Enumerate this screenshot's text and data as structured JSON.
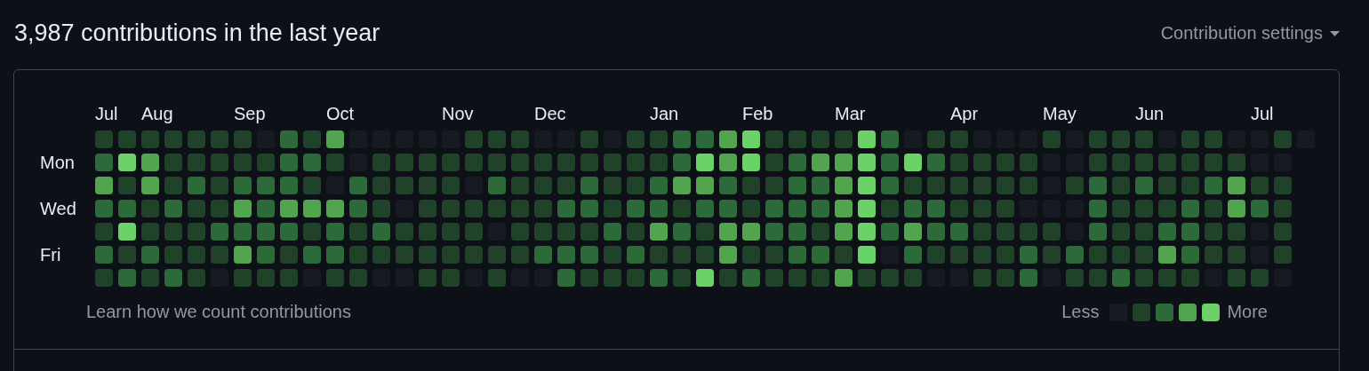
{
  "header": {
    "title": "3,987 contributions in the last year",
    "settings_label": "Contribution settings"
  },
  "day_labels": [
    "Mon",
    "Wed",
    "Fri"
  ],
  "weeks": [
    {
      "month": "Jul",
      "days": [
        {
          "color": "#1f4229"
        },
        {
          "color": "#2d6a39"
        },
        {
          "color": "#52a44e"
        },
        {
          "color": "#2d6a39"
        },
        {
          "color": "#1f4229"
        },
        {
          "color": "#2d6a39"
        },
        {
          "color": "#1f4229"
        }
      ]
    },
    {
      "days": [
        {
          "color": "#1f4229"
        },
        {
          "color": "#6bd267"
        },
        {
          "color": "#1f4229"
        },
        {
          "color": "#2d6a39"
        },
        {
          "color": "#6bd267"
        },
        {
          "color": "#1f4229"
        },
        {
          "color": "#2d6a39"
        }
      ]
    },
    {
      "month": "Aug",
      "days": [
        {
          "color": "#1f4229"
        },
        {
          "color": "#52a44e"
        },
        {
          "color": "#52a44e"
        },
        {
          "color": "#1f4229"
        },
        {
          "color": "#1f4229"
        },
        {
          "color": "#2d6a39"
        },
        {
          "color": "#1f4229"
        }
      ]
    },
    {
      "days": [
        {
          "color": "#1f4229"
        },
        {
          "color": "#1f4229"
        },
        {
          "color": "#1f4229"
        },
        {
          "color": "#2d6a39"
        },
        {
          "color": "#1f4229"
        },
        {
          "color": "#1f4229"
        },
        {
          "color": "#2d6a39"
        }
      ]
    },
    {
      "days": [
        {
          "color": "#1f4229"
        },
        {
          "color": "#1f4229"
        },
        {
          "color": "#2d6a39"
        },
        {
          "color": "#1f4229"
        },
        {
          "color": "#1f4229"
        },
        {
          "color": "#1f4229"
        },
        {
          "color": "#1f4229"
        }
      ]
    },
    {
      "days": [
        {
          "color": "#1f4229"
        },
        {
          "color": "#1f4229"
        },
        {
          "color": "#1f4229"
        },
        {
          "color": "#1f4229"
        },
        {
          "color": "#2d6a39"
        },
        {
          "color": "#1f4229"
        },
        {
          "color": "#161b22"
        }
      ]
    },
    {
      "month": "Sep",
      "days": [
        {
          "color": "#1f4229"
        },
        {
          "color": "#1f4229"
        },
        {
          "color": "#2d6a39"
        },
        {
          "color": "#52a44e"
        },
        {
          "color": "#2d6a39"
        },
        {
          "color": "#52a44e"
        },
        {
          "color": "#1f4229"
        }
      ]
    },
    {
      "days": [
        {
          "color": "#161b22"
        },
        {
          "color": "#1f4229"
        },
        {
          "color": "#2d6a39"
        },
        {
          "color": "#2d6a39"
        },
        {
          "color": "#2d6a39"
        },
        {
          "color": "#2d6a39"
        },
        {
          "color": "#1f4229"
        }
      ]
    },
    {
      "days": [
        {
          "color": "#2d6a39"
        },
        {
          "color": "#2d6a39"
        },
        {
          "color": "#2d6a39"
        },
        {
          "color": "#52a44e"
        },
        {
          "color": "#2d6a39"
        },
        {
          "color": "#1f4229"
        },
        {
          "color": "#1f4229"
        }
      ]
    },
    {
      "days": [
        {
          "color": "#1f4229"
        },
        {
          "color": "#2d6a39"
        },
        {
          "color": "#1f4229"
        },
        {
          "color": "#52a44e"
        },
        {
          "color": "#1f4229"
        },
        {
          "color": "#2d6a39"
        },
        {
          "color": "#161b22"
        }
      ]
    },
    {
      "month": "Oct",
      "days": [
        {
          "color": "#52a44e"
        },
        {
          "color": "#1f4229"
        },
        {
          "color": "#161b22"
        },
        {
          "color": "#52a44e"
        },
        {
          "color": "#2d6a39"
        },
        {
          "color": "#2d6a39"
        },
        {
          "color": "#1f4229"
        }
      ]
    },
    {
      "days": [
        {
          "color": "#161b22"
        },
        {
          "color": "#161b22"
        },
        {
          "color": "#2d6a39"
        },
        {
          "color": "#2d6a39"
        },
        {
          "color": "#1f4229"
        },
        {
          "color": "#1f4229"
        },
        {
          "color": "#1f4229"
        }
      ]
    },
    {
      "days": [
        {
          "color": "#161b22"
        },
        {
          "color": "#1f4229"
        },
        {
          "color": "#1f4229"
        },
        {
          "color": "#1f4229"
        },
        {
          "color": "#2d6a39"
        },
        {
          "color": "#1f4229"
        },
        {
          "color": "#161b22"
        }
      ]
    },
    {
      "days": [
        {
          "color": "#161b22"
        },
        {
          "color": "#1f4229"
        },
        {
          "color": "#1f4229"
        },
        {
          "color": "#161b22"
        },
        {
          "color": "#1f4229"
        },
        {
          "color": "#1f4229"
        },
        {
          "color": "#161b22"
        }
      ]
    },
    {
      "days": [
        {
          "color": "#161b22"
        },
        {
          "color": "#1f4229"
        },
        {
          "color": "#1f4229"
        },
        {
          "color": "#1f4229"
        },
        {
          "color": "#1f4229"
        },
        {
          "color": "#1f4229"
        },
        {
          "color": "#1f4229"
        }
      ]
    },
    {
      "month": "Nov",
      "days": [
        {
          "color": "#161b22"
        },
        {
          "color": "#1f4229"
        },
        {
          "color": "#1f4229"
        },
        {
          "color": "#1f4229"
        },
        {
          "color": "#1f4229"
        },
        {
          "color": "#1f4229"
        },
        {
          "color": "#1f4229"
        }
      ]
    },
    {
      "days": [
        {
          "color": "#1f4229"
        },
        {
          "color": "#1f4229"
        },
        {
          "color": "#161b22"
        },
        {
          "color": "#1f4229"
        },
        {
          "color": "#1f4229"
        },
        {
          "color": "#1f4229"
        },
        {
          "color": "#161b22"
        }
      ]
    },
    {
      "days": [
        {
          "color": "#1f4229"
        },
        {
          "color": "#1f4229"
        },
        {
          "color": "#2d6a39"
        },
        {
          "color": "#1f4229"
        },
        {
          "color": "#161b22"
        },
        {
          "color": "#1f4229"
        },
        {
          "color": "#1f4229"
        }
      ]
    },
    {
      "days": [
        {
          "color": "#1f4229"
        },
        {
          "color": "#1f4229"
        },
        {
          "color": "#1f4229"
        },
        {
          "color": "#1f4229"
        },
        {
          "color": "#1f4229"
        },
        {
          "color": "#1f4229"
        },
        {
          "color": "#161b22"
        }
      ]
    },
    {
      "month": "Dec",
      "days": [
        {
          "color": "#161b22"
        },
        {
          "color": "#1f4229"
        },
        {
          "color": "#1f4229"
        },
        {
          "color": "#1f4229"
        },
        {
          "color": "#1f4229"
        },
        {
          "color": "#2d6a39"
        },
        {
          "color": "#161b22"
        }
      ]
    },
    {
      "days": [
        {
          "color": "#161b22"
        },
        {
          "color": "#1f4229"
        },
        {
          "color": "#1f4229"
        },
        {
          "color": "#2d6a39"
        },
        {
          "color": "#1f4229"
        },
        {
          "color": "#2d6a39"
        },
        {
          "color": "#2d6a39"
        }
      ]
    },
    {
      "days": [
        {
          "color": "#1f4229"
        },
        {
          "color": "#1f4229"
        },
        {
          "color": "#2d6a39"
        },
        {
          "color": "#2d6a39"
        },
        {
          "color": "#1f4229"
        },
        {
          "color": "#2d6a39"
        },
        {
          "color": "#1f4229"
        }
      ]
    },
    {
      "days": [
        {
          "color": "#161b22"
        },
        {
          "color": "#1f4229"
        },
        {
          "color": "#1f4229"
        },
        {
          "color": "#1f4229"
        },
        {
          "color": "#2d6a39"
        },
        {
          "color": "#1f4229"
        },
        {
          "color": "#1f4229"
        }
      ]
    },
    {
      "days": [
        {
          "color": "#1f4229"
        },
        {
          "color": "#1f4229"
        },
        {
          "color": "#1f4229"
        },
        {
          "color": "#2d6a39"
        },
        {
          "color": "#1f4229"
        },
        {
          "color": "#2d6a39"
        },
        {
          "color": "#1f4229"
        }
      ]
    },
    {
      "month": "Jan",
      "days": [
        {
          "color": "#1f4229"
        },
        {
          "color": "#1f4229"
        },
        {
          "color": "#2d6a39"
        },
        {
          "color": "#2d6a39"
        },
        {
          "color": "#52a44e"
        },
        {
          "color": "#1f4229"
        },
        {
          "color": "#2d6a39"
        }
      ]
    },
    {
      "days": [
        {
          "color": "#2d6a39"
        },
        {
          "color": "#2d6a39"
        },
        {
          "color": "#52a44e"
        },
        {
          "color": "#1f4229"
        },
        {
          "color": "#2d6a39"
        },
        {
          "color": "#1f4229"
        },
        {
          "color": "#1f4229"
        }
      ]
    },
    {
      "days": [
        {
          "color": "#2d6a39"
        },
        {
          "color": "#6bd267"
        },
        {
          "color": "#52a44e"
        },
        {
          "color": "#2d6a39"
        },
        {
          "color": "#1f4229"
        },
        {
          "color": "#1f4229"
        },
        {
          "color": "#6bd267"
        }
      ]
    },
    {
      "days": [
        {
          "color": "#52a44e"
        },
        {
          "color": "#52a44e"
        },
        {
          "color": "#2d6a39"
        },
        {
          "color": "#2d6a39"
        },
        {
          "color": "#52a44e"
        },
        {
          "color": "#52a44e"
        },
        {
          "color": "#1f4229"
        }
      ]
    },
    {
      "month": "Feb",
      "days": [
        {
          "color": "#6bd267"
        },
        {
          "color": "#6bd267"
        },
        {
          "color": "#1f4229"
        },
        {
          "color": "#1f4229"
        },
        {
          "color": "#52a44e"
        },
        {
          "color": "#1f4229"
        },
        {
          "color": "#2d6a39"
        }
      ]
    },
    {
      "days": [
        {
          "color": "#1f4229"
        },
        {
          "color": "#1f4229"
        },
        {
          "color": "#1f4229"
        },
        {
          "color": "#2d6a39"
        },
        {
          "color": "#2d6a39"
        },
        {
          "color": "#1f4229"
        },
        {
          "color": "#1f4229"
        }
      ]
    },
    {
      "days": [
        {
          "color": "#1f4229"
        },
        {
          "color": "#2d6a39"
        },
        {
          "color": "#2d6a39"
        },
        {
          "color": "#2d6a39"
        },
        {
          "color": "#2d6a39"
        },
        {
          "color": "#2d6a39"
        },
        {
          "color": "#1f4229"
        }
      ]
    },
    {
      "days": [
        {
          "color": "#1f4229"
        },
        {
          "color": "#52a44e"
        },
        {
          "color": "#2d6a39"
        },
        {
          "color": "#2d6a39"
        },
        {
          "color": "#1f4229"
        },
        {
          "color": "#2d6a39"
        },
        {
          "color": "#1f4229"
        }
      ]
    },
    {
      "month": "Mar",
      "days": [
        {
          "color": "#1f4229"
        },
        {
          "color": "#52a44e"
        },
        {
          "color": "#52a44e"
        },
        {
          "color": "#52a44e"
        },
        {
          "color": "#52a44e"
        },
        {
          "color": "#1f4229"
        },
        {
          "color": "#52a44e"
        }
      ]
    },
    {
      "days": [
        {
          "color": "#6bd267"
        },
        {
          "color": "#6bd267"
        },
        {
          "color": "#6bd267"
        },
        {
          "color": "#6bd267"
        },
        {
          "color": "#6bd267"
        },
        {
          "color": "#6bd267"
        },
        {
          "color": "#1f4229"
        }
      ]
    },
    {
      "days": [
        {
          "color": "#2d6a39"
        },
        {
          "color": "#2d6a39"
        },
        {
          "color": "#2d6a39"
        },
        {
          "color": "#1f4229"
        },
        {
          "color": "#2d6a39"
        },
        {
          "color": "#161b22"
        },
        {
          "color": "#1f4229"
        }
      ]
    },
    {
      "days": [
        {
          "color": "#161b22"
        },
        {
          "color": "#6bd267"
        },
        {
          "color": "#1f4229"
        },
        {
          "color": "#2d6a39"
        },
        {
          "color": "#52a44e"
        },
        {
          "color": "#2d6a39"
        },
        {
          "color": "#1f4229"
        }
      ]
    },
    {
      "days": [
        {
          "color": "#1f4229"
        },
        {
          "color": "#2d6a39"
        },
        {
          "color": "#1f4229"
        },
        {
          "color": "#2d6a39"
        },
        {
          "color": "#2d6a39"
        },
        {
          "color": "#1f4229"
        },
        {
          "color": "#161b22"
        }
      ]
    },
    {
      "month": "Apr",
      "days": [
        {
          "color": "#1f4229"
        },
        {
          "color": "#1f4229"
        },
        {
          "color": "#1f4229"
        },
        {
          "color": "#1f4229"
        },
        {
          "color": "#2d6a39"
        },
        {
          "color": "#1f4229"
        },
        {
          "color": "#161b22"
        }
      ]
    },
    {
      "days": [
        {
          "color": "#161b22"
        },
        {
          "color": "#1f4229"
        },
        {
          "color": "#1f4229"
        },
        {
          "color": "#1f4229"
        },
        {
          "color": "#1f4229"
        },
        {
          "color": "#1f4229"
        },
        {
          "color": "#1f4229"
        }
      ]
    },
    {
      "days": [
        {
          "color": "#161b22"
        },
        {
          "color": "#1f4229"
        },
        {
          "color": "#1f4229"
        },
        {
          "color": "#1f4229"
        },
        {
          "color": "#1f4229"
        },
        {
          "color": "#1f4229"
        },
        {
          "color": "#1f4229"
        }
      ]
    },
    {
      "days": [
        {
          "color": "#161b22"
        },
        {
          "color": "#1f4229"
        },
        {
          "color": "#1f4229"
        },
        {
          "color": "#161b22"
        },
        {
          "color": "#1f4229"
        },
        {
          "color": "#2d6a39"
        },
        {
          "color": "#2d6a39"
        }
      ]
    },
    {
      "month": "May",
      "days": [
        {
          "color": "#1f4229"
        },
        {
          "color": "#161b22"
        },
        {
          "color": "#161b22"
        },
        {
          "color": "#161b22"
        },
        {
          "color": "#1f4229"
        },
        {
          "color": "#1f4229"
        },
        {
          "color": "#161b22"
        }
      ]
    },
    {
      "days": [
        {
          "color": "#161b22"
        },
        {
          "color": "#161b22"
        },
        {
          "color": "#1f4229"
        },
        {
          "color": "#161b22"
        },
        {
          "color": "#161b22"
        },
        {
          "color": "#2d6a39"
        },
        {
          "color": "#1f4229"
        }
      ]
    },
    {
      "days": [
        {
          "color": "#1f4229"
        },
        {
          "color": "#1f4229"
        },
        {
          "color": "#2d6a39"
        },
        {
          "color": "#2d6a39"
        },
        {
          "color": "#2d6a39"
        },
        {
          "color": "#1f4229"
        },
        {
          "color": "#1f4229"
        }
      ]
    },
    {
      "days": [
        {
          "color": "#1f4229"
        },
        {
          "color": "#1f4229"
        },
        {
          "color": "#1f4229"
        },
        {
          "color": "#1f4229"
        },
        {
          "color": "#1f4229"
        },
        {
          "color": "#1f4229"
        },
        {
          "color": "#2d6a39"
        }
      ]
    },
    {
      "month": "Jun",
      "days": [
        {
          "color": "#1f4229"
        },
        {
          "color": "#1f4229"
        },
        {
          "color": "#2d6a39"
        },
        {
          "color": "#1f4229"
        },
        {
          "color": "#1f4229"
        },
        {
          "color": "#1f4229"
        },
        {
          "color": "#1f4229"
        }
      ]
    },
    {
      "days": [
        {
          "color": "#161b22"
        },
        {
          "color": "#1f4229"
        },
        {
          "color": "#1f4229"
        },
        {
          "color": "#1f4229"
        },
        {
          "color": "#2d6a39"
        },
        {
          "color": "#52a44e"
        },
        {
          "color": "#1f4229"
        }
      ]
    },
    {
      "days": [
        {
          "color": "#1f4229"
        },
        {
          "color": "#1f4229"
        },
        {
          "color": "#1f4229"
        },
        {
          "color": "#2d6a39"
        },
        {
          "color": "#2d6a39"
        },
        {
          "color": "#2d6a39"
        },
        {
          "color": "#1f4229"
        }
      ]
    },
    {
      "days": [
        {
          "color": "#1f4229"
        },
        {
          "color": "#1f4229"
        },
        {
          "color": "#2d6a39"
        },
        {
          "color": "#1f4229"
        },
        {
          "color": "#1f4229"
        },
        {
          "color": "#1f4229"
        },
        {
          "color": "#161b22"
        }
      ]
    },
    {
      "days": [
        {
          "color": "#161b22"
        },
        {
          "color": "#1f4229"
        },
        {
          "color": "#52a44e"
        },
        {
          "color": "#52a44e"
        },
        {
          "color": "#1f4229"
        },
        {
          "color": "#1f4229"
        },
        {
          "color": "#1f4229"
        }
      ]
    },
    {
      "month": "Jul",
      "days": [
        {
          "color": "#161b22"
        },
        {
          "color": "#161b22"
        },
        {
          "color": "#1f4229"
        },
        {
          "color": "#2d6a39"
        },
        {
          "color": "#161b22"
        },
        {
          "color": "#161b22"
        },
        {
          "color": "#1f4229"
        }
      ]
    },
    {
      "days": [
        {
          "color": "#1f4229"
        },
        {
          "color": "#161b22"
        },
        {
          "color": "#1f4229"
        },
        {
          "color": "#1f4229"
        },
        {
          "color": "#1f4229"
        },
        {
          "color": "#1f4229"
        },
        {
          "color": "#161b22"
        }
      ]
    },
    {
      "days": [
        {
          "color": "#161b22"
        }
      ]
    }
  ],
  "footer": {
    "link": "Learn how we count contributions",
    "less_label": "Less",
    "more_label": "More",
    "legend": [
      {
        "color": "#161b22"
      },
      {
        "color": "#1f4229"
      },
      {
        "color": "#2d6a39"
      },
      {
        "color": "#52a44e"
      },
      {
        "color": "#6bd267"
      }
    ]
  }
}
